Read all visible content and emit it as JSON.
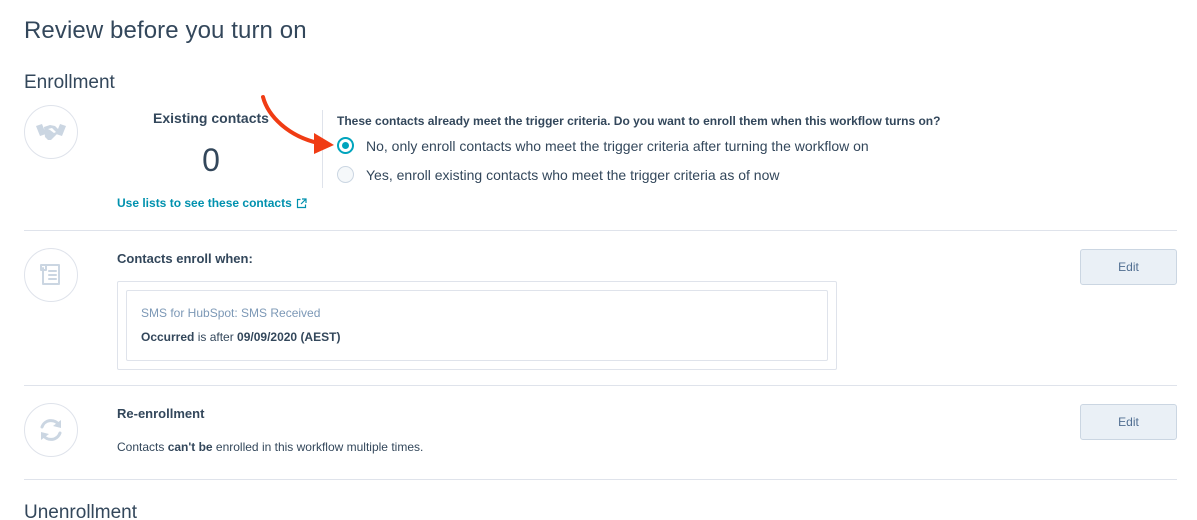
{
  "page": {
    "title": "Review before you turn on"
  },
  "enrollment": {
    "title": "Enrollment",
    "icon": "handshake-icon",
    "existing_label": "Existing contacts",
    "existing_count": "0",
    "use_lists_link": "Use lists to see these contacts",
    "question": "These contacts already meet the trigger criteria. Do you want to enroll them when this workflow turns on?",
    "options": [
      {
        "label": "No, only enroll contacts who meet the trigger criteria after turning the workflow on",
        "selected": true
      },
      {
        "label": "Yes, enroll existing contacts who meet the trigger criteria as of now",
        "selected": false
      }
    ]
  },
  "enroll_when": {
    "icon": "document-list-icon",
    "heading": "Contacts enroll when:",
    "edit_label": "Edit",
    "criteria": {
      "source": "SMS for HubSpot: SMS Received",
      "property": "Occurred",
      "operator": " is after ",
      "value": "09/09/2020 (AEST)"
    }
  },
  "reenrollment": {
    "icon": "refresh-icon",
    "heading": "Re-enrollment",
    "edit_label": "Edit",
    "desc_prefix": "Contacts ",
    "desc_bold": "can't be",
    "desc_suffix": " enrolled in this workflow multiple times."
  },
  "unenrollment": {
    "title": "Unenrollment"
  },
  "colors": {
    "accent": "#00a4bd",
    "link": "#0091ae",
    "text": "#33475b",
    "annotation_arrow": "#f03c14"
  }
}
